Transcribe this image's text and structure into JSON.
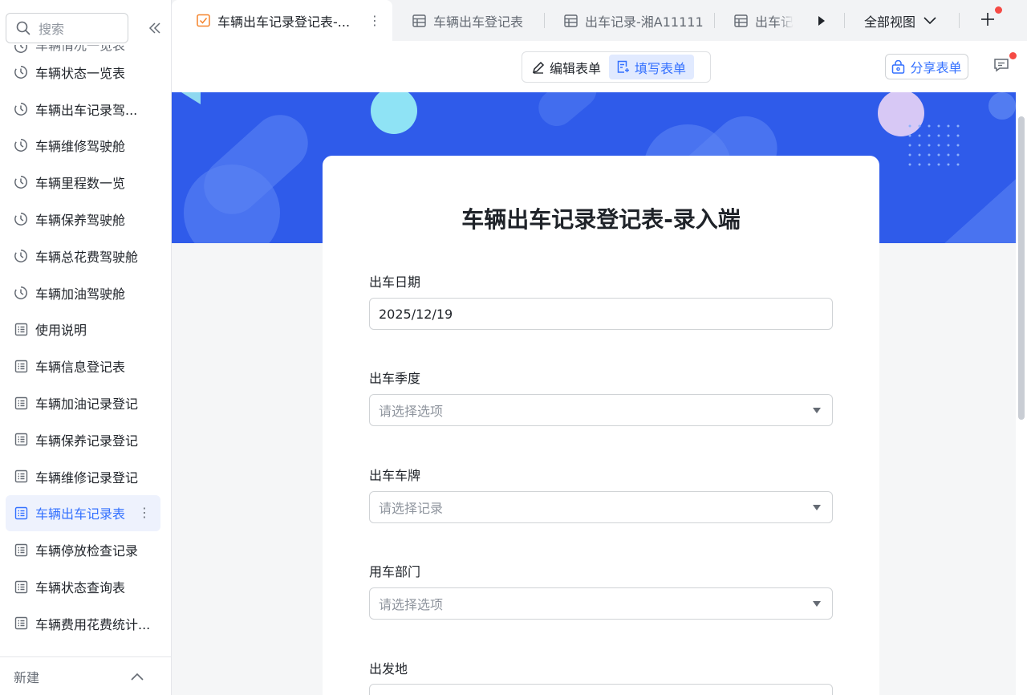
{
  "sidebar": {
    "search_placeholder": "搜索",
    "items": [
      {
        "label": "车辆情况一览表",
        "icon": "dashboard-icon"
      },
      {
        "label": "车辆状态一览表",
        "icon": "dashboard-icon"
      },
      {
        "label": "车辆出车记录驾...",
        "icon": "dashboard-icon"
      },
      {
        "label": "车辆维修驾驶舱",
        "icon": "dashboard-icon"
      },
      {
        "label": "车辆里程数一览",
        "icon": "dashboard-icon"
      },
      {
        "label": "车辆保养驾驶舱",
        "icon": "dashboard-icon"
      },
      {
        "label": "车辆总花费驾驶舱",
        "icon": "dashboard-icon"
      },
      {
        "label": "车辆加油驾驶舱",
        "icon": "dashboard-icon"
      },
      {
        "label": "使用说明",
        "icon": "doc-icon"
      },
      {
        "label": "车辆信息登记表",
        "icon": "doc-icon"
      },
      {
        "label": "车辆加油记录登记",
        "icon": "doc-icon"
      },
      {
        "label": "车辆保养记录登记",
        "icon": "doc-icon"
      },
      {
        "label": "车辆维修记录登记",
        "icon": "doc-icon"
      },
      {
        "label": "车辆出车记录表",
        "icon": "doc-icon"
      },
      {
        "label": "车辆停放检查记录",
        "icon": "doc-icon"
      },
      {
        "label": "车辆状态查询表",
        "icon": "doc-icon"
      },
      {
        "label": "车辆费用花费统计...",
        "icon": "doc-icon"
      }
    ],
    "footer_label": "新建"
  },
  "tabs": [
    {
      "label": "车辆出车记录登记表-...",
      "icon": "form-icon"
    },
    {
      "label": "车辆出车登记表",
      "icon": "grid-icon"
    },
    {
      "label": "出车记录-湘A11111",
      "icon": "grid-icon"
    },
    {
      "label": "出车记",
      "icon": "grid-icon"
    }
  ],
  "all_views_label": "全部视图",
  "toolbar": {
    "edit_form_label": "编辑表单",
    "fill_form_label": "填写表单",
    "share_form_label": "分享表单"
  },
  "form": {
    "title": "车辆出车记录登记表-录入端",
    "fields": [
      {
        "label": "出车日期",
        "value": "2025/12/19",
        "placeholder": ""
      },
      {
        "label": "出车季度",
        "value": "",
        "placeholder": "请选择选项"
      },
      {
        "label": "出车车牌",
        "value": "",
        "placeholder": "请选择记录"
      },
      {
        "label": "用车部门",
        "value": "",
        "placeholder": "请选择选项"
      },
      {
        "label": "出发地",
        "value": "",
        "placeholder": ""
      }
    ]
  },
  "colors": {
    "accent": "#3370ff",
    "banner": "#2f5bea",
    "active_bg": "#eef2fd",
    "notification_dot": "#f54a45"
  }
}
